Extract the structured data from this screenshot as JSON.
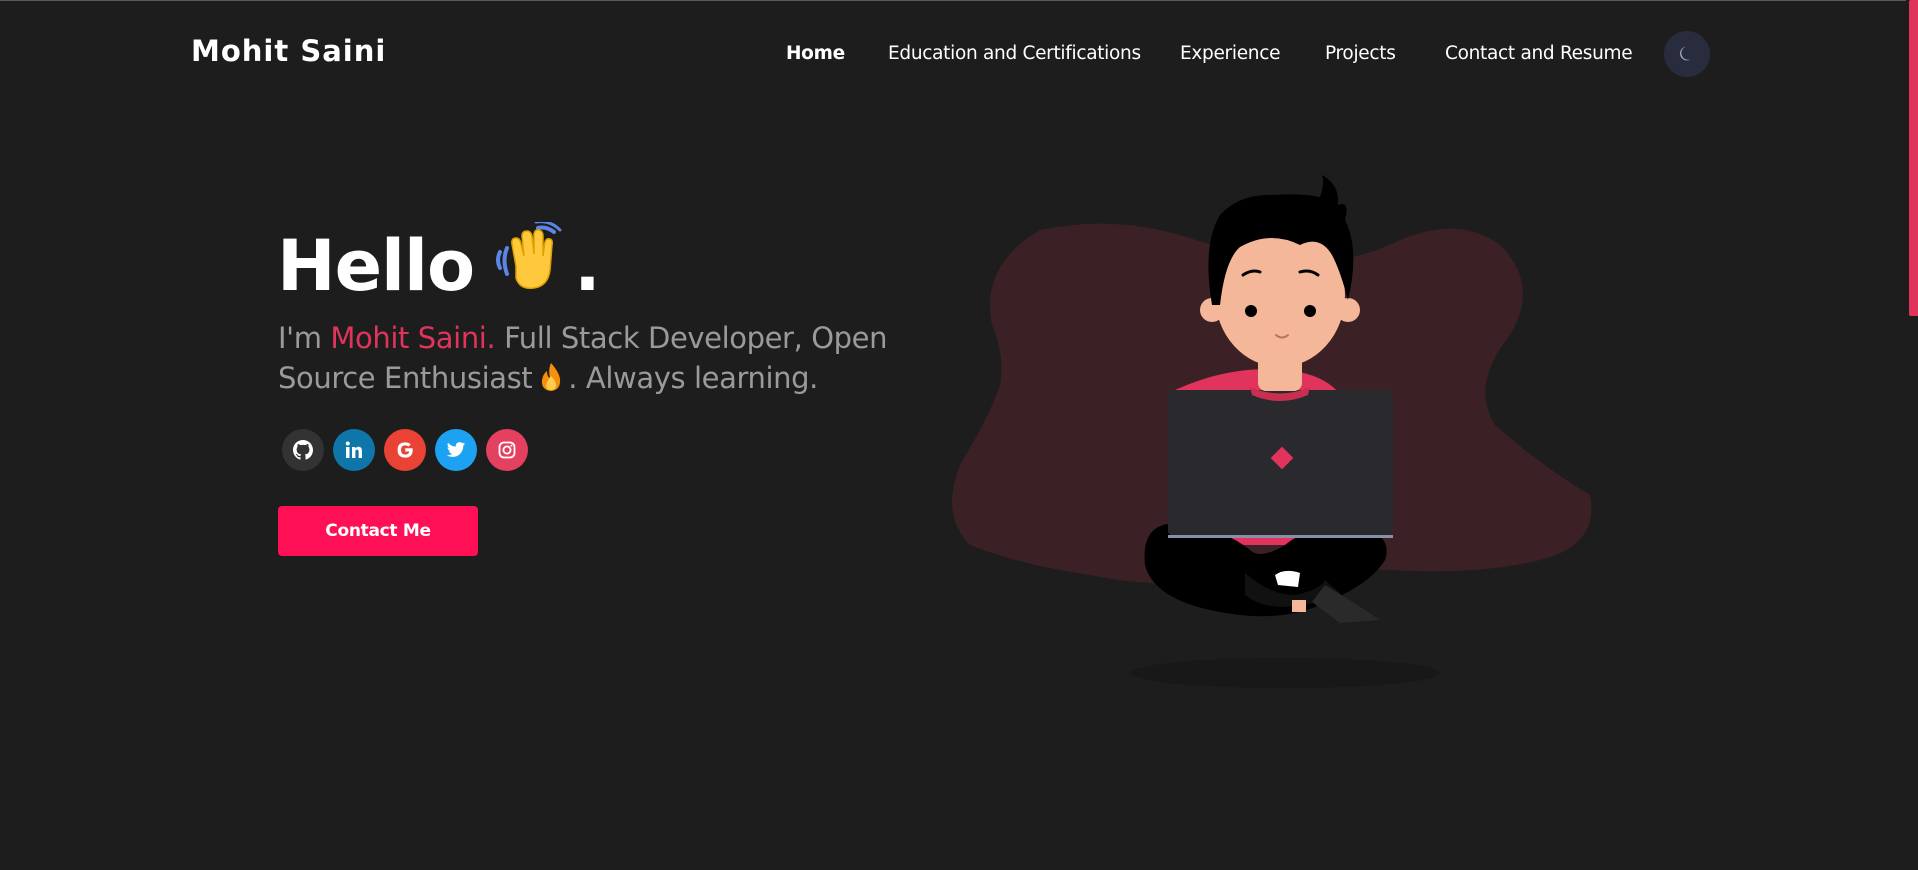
{
  "header": {
    "logo": "Mohit Saini",
    "nav": [
      {
        "label": "Home",
        "active": true
      },
      {
        "label": "Education and Certifications",
        "active": false
      },
      {
        "label": "Experience",
        "active": false
      },
      {
        "label": "Projects",
        "active": false
      },
      {
        "label": "Contact and Resume",
        "active": false
      }
    ],
    "theme_toggle_icon": "moon-icon"
  },
  "hero": {
    "greeting": "Hello",
    "greeting_emoji": "waving-hand-icon",
    "greeting_end": ".",
    "subtitle_prefix": "I'm ",
    "name": "Mohit Saini.",
    "subtitle_part1": " Full Stack Developer, Open Source Enthusiast",
    "subtitle_emoji": "fire-icon",
    "subtitle_part2": ". Always learning.",
    "socials": [
      {
        "icon": "github-icon",
        "color": "#333333"
      },
      {
        "icon": "linkedin-icon",
        "color": "#0e76a8"
      },
      {
        "icon": "google-icon",
        "color": "#ea4335"
      },
      {
        "icon": "twitter-icon",
        "color": "#1da1f2"
      },
      {
        "icon": "instagram-icon",
        "color": "#e4405f"
      }
    ],
    "cta_label": "Contact Me",
    "illustration": "developer-with-laptop-illustration"
  },
  "colors": {
    "background": "#1d1d1d",
    "accent": "#e0345c",
    "button": "#ff0f55",
    "blob": "#3b2025"
  }
}
